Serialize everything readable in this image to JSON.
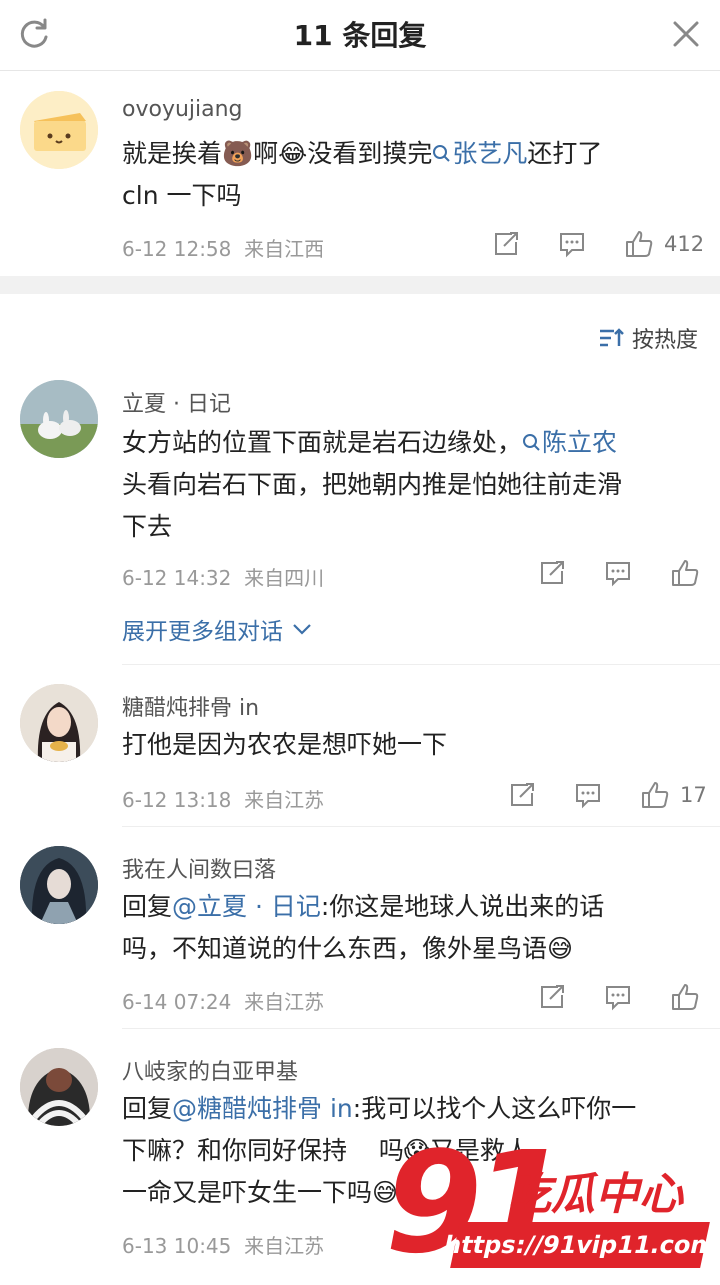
{
  "header": {
    "title": "11 条回复",
    "refresh_icon": "refresh-icon",
    "close_icon": "close-icon"
  },
  "root_comment": {
    "user": "ovoyujiang",
    "text_before": "就是挨着",
    "emoji_bear": "🐻",
    "text_mid1": "啊",
    "emoji_laugh": "😂",
    "text_mid2": "没看到摸完",
    "mention_search": "张艺凡",
    "text_after": "还打了",
    "text_line2": "cln 一下吗",
    "time": "6-12 12:58",
    "location": "来自江西",
    "likes": "412"
  },
  "sort": {
    "label": "按热度"
  },
  "comments": [
    {
      "user": "立夏 · 日记",
      "line1": "女方站的位置下面就是岩石边缘处，",
      "mention": "陈立农",
      "line2": "头看向岩石下面，把她朝内推是怕她往前走滑",
      "line3": "下去",
      "time": "6-12 14:32",
      "location": "来自四川",
      "likes": ""
    },
    {
      "user": "糖醋炖排骨 in",
      "line1": "打他是因为农农是想吓她一下",
      "time": "6-12 13:18",
      "location": "来自江苏",
      "likes": "17"
    },
    {
      "user": "我在人间数曰落",
      "reply_prefix": "回复",
      "reply_to": "@立夏 · 日记",
      "line1": ":你这是地球人说出来的话",
      "line2": "吗，不知道说的什么东西，像外星鸟语",
      "emoji": "😅",
      "time": "6-14 07:24",
      "location": "来自江苏",
      "likes": ""
    },
    {
      "user": "八岐家的白亚甲基",
      "reply_prefix": "回复",
      "reply_to": "@糖醋炖排骨 in",
      "line1": ":我可以找个人这么吓你一",
      "line2a": "下嘛？和你同好保持",
      "line2b": "吗",
      "emoji1": "😱",
      "line2c": "又是救人",
      "line3": "一命又是吓女生一下吗",
      "emoji2": "😅",
      "time": "6-13 10:45",
      "location": "来自江苏"
    }
  ],
  "expand_more": "展开更多组对话",
  "watermark": {
    "number": "91",
    "slogan": "吃瓜中心",
    "url": "https://91vip11.com"
  }
}
